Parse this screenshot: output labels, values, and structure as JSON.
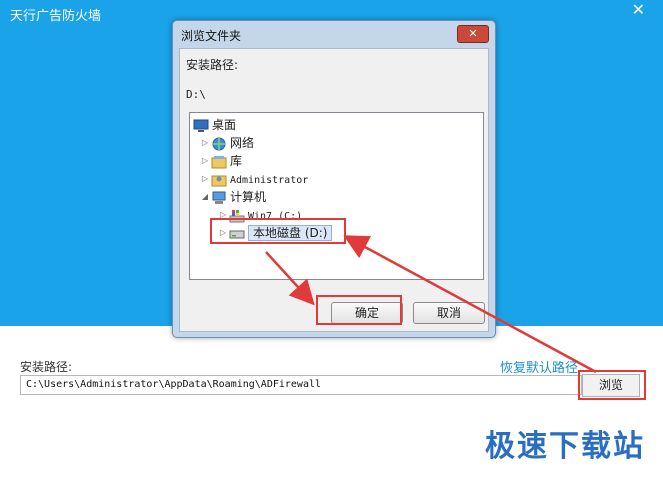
{
  "app": {
    "title": "天行广告防火墙",
    "close_glyph": "✕",
    "path_label": "安装路径:",
    "install_path": "C:\\Users\\Administrator\\AppData\\Roaming\\ADFirewall",
    "restore_default": "恢复默认路径",
    "browse_label": "浏览"
  },
  "dialog": {
    "title": "浏览文件夹",
    "close_glyph": "✕",
    "label": "安装路径:",
    "current_path": "D:\\",
    "tree": [
      {
        "label": "桌面",
        "icon": "desktop-icon",
        "selected": false
      },
      {
        "label": "网络",
        "icon": "network-icon",
        "selected": false
      },
      {
        "label": "库",
        "icon": "library-icon",
        "selected": false
      },
      {
        "label": "Administrator",
        "icon": "user-folder-icon",
        "selected": false
      },
      {
        "label": "计算机",
        "icon": "computer-icon",
        "selected": false
      },
      {
        "label": "Win7 (C:)",
        "icon": "drive-c-icon",
        "selected": false
      },
      {
        "label": "本地磁盘 (D:)",
        "icon": "drive-d-icon",
        "selected": true
      }
    ],
    "ok_label": "确定",
    "cancel_label": "取消"
  },
  "watermark": "极速下载站",
  "colors": {
    "app_blue": "#1aa3e8",
    "highlight_red": "#e03a3a",
    "link_blue": "#1a8fd0"
  }
}
